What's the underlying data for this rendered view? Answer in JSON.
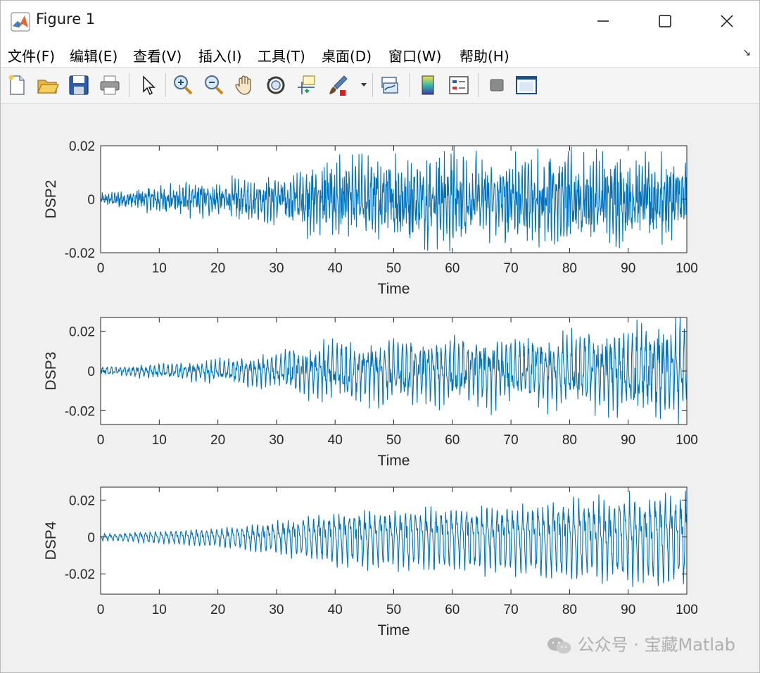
{
  "window": {
    "title": "Figure 1"
  },
  "menu": [
    "文件(F)",
    "编辑(E)",
    "查看(V)",
    "插入(I)",
    "工具(T)",
    "桌面(D)",
    "窗口(W)",
    "帮助(H)"
  ],
  "toolbar_icons": [
    "new-figure-icon",
    "open-file-icon",
    "save-icon",
    "print-icon",
    "select-arrow-icon",
    "zoom-in-icon",
    "zoom-out-icon",
    "pan-hand-icon",
    "rotate-3d-icon",
    "data-cursor-icon",
    "brush-icon",
    "link-plot-icon",
    "colorbar-icon",
    "legend-icon",
    "hide-plot-tools-icon",
    "show-plot-tools-icon"
  ],
  "colors": {
    "line": "#0072BD",
    "axes_bg": "#ffffff",
    "figure_bg": "#f0f0f0"
  },
  "watermark": "公众号 · 宝藏Matlab",
  "chart_data": [
    {
      "type": "line",
      "title": "",
      "xlabel": "Time",
      "ylabel": "DSP2",
      "xlim": [
        0,
        100
      ],
      "ylim": [
        -0.02,
        0.02
      ],
      "xticks": [
        0,
        10,
        20,
        30,
        40,
        50,
        60,
        70,
        80,
        90,
        100
      ],
      "yticks": [
        -0.02,
        0,
        0.02
      ],
      "ytick_labels": [
        "-0.02",
        "0",
        "0.02"
      ],
      "x": [
        0,
        10,
        20,
        30,
        40,
        50,
        60,
        70,
        80,
        90,
        100
      ],
      "amplitude_envelope": [
        0.002,
        0.005,
        0.006,
        0.008,
        0.014,
        0.015,
        0.016,
        0.015,
        0.017,
        0.015,
        0.015
      ],
      "grid": false
    },
    {
      "type": "line",
      "title": "",
      "xlabel": "Time",
      "ylabel": "DSP3",
      "xlim": [
        0,
        100
      ],
      "ylim": [
        -0.027,
        0.027
      ],
      "xticks": [
        0,
        10,
        20,
        30,
        40,
        50,
        60,
        70,
        80,
        90,
        100
      ],
      "yticks": [
        -0.02,
        0,
        0.02
      ],
      "ytick_labels": [
        "-0.02",
        "0",
        "0.02"
      ],
      "x": [
        0,
        10,
        20,
        30,
        40,
        50,
        60,
        70,
        80,
        90,
        100
      ],
      "amplitude_envelope": [
        0.002,
        0.004,
        0.006,
        0.01,
        0.016,
        0.017,
        0.018,
        0.018,
        0.021,
        0.025,
        0.027
      ],
      "grid": false
    },
    {
      "type": "line",
      "title": "",
      "xlabel": "Time",
      "ylabel": "DSP4",
      "xlim": [
        0,
        100
      ],
      "ylim": [
        -0.031,
        0.027
      ],
      "xticks": [
        0,
        10,
        20,
        30,
        40,
        50,
        60,
        70,
        80,
        90,
        100
      ],
      "yticks": [
        -0.02,
        0,
        0.02
      ],
      "ytick_labels": [
        "-0.02",
        "0",
        "0.02"
      ],
      "x": [
        0,
        10,
        20,
        30,
        40,
        50,
        60,
        70,
        80,
        90,
        100
      ],
      "amplitude_envelope": [
        0.002,
        0.004,
        0.006,
        0.01,
        0.017,
        0.018,
        0.02,
        0.021,
        0.025,
        0.027,
        0.029
      ],
      "grid": false
    }
  ]
}
